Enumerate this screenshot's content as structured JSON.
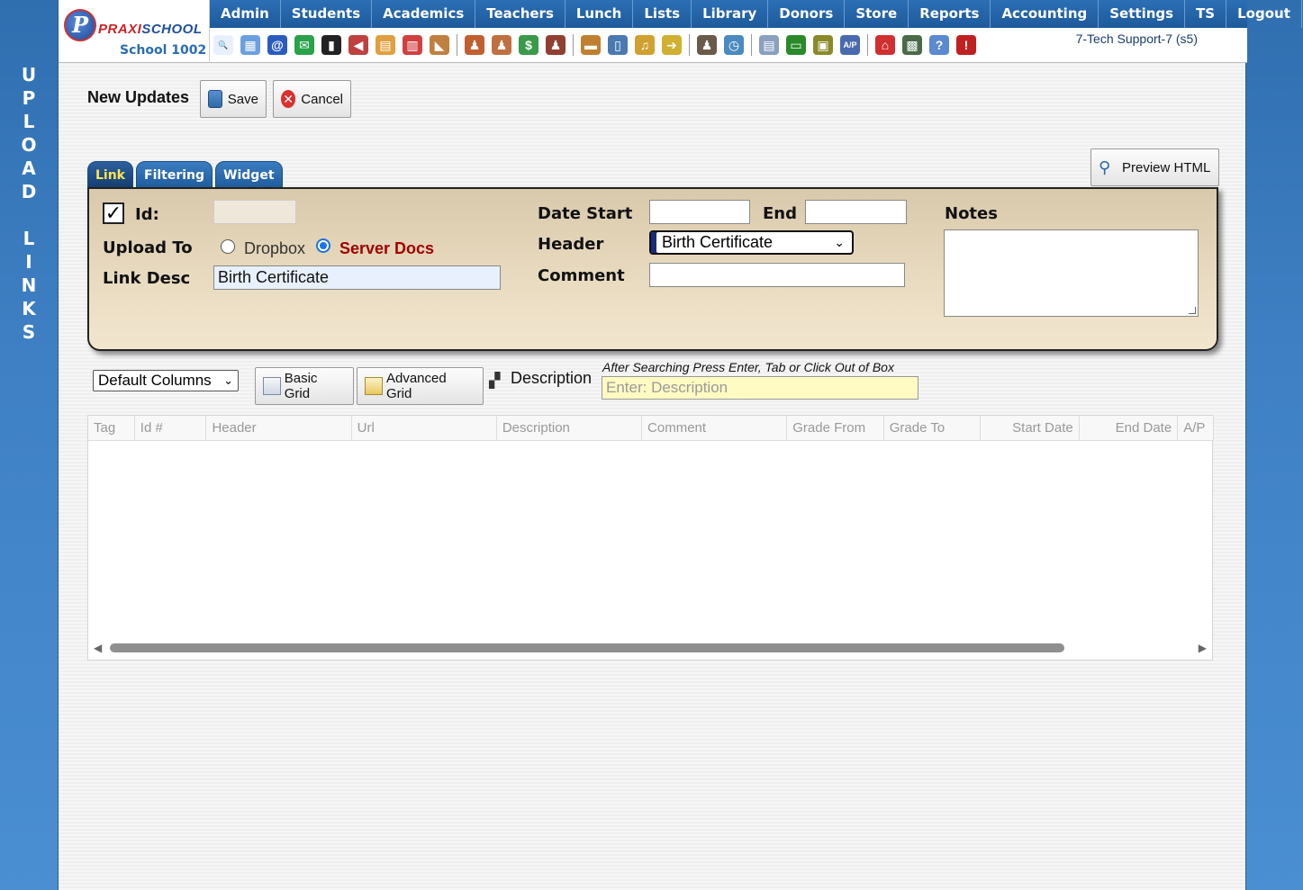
{
  "side_title": [
    "U",
    "P",
    "L",
    "O",
    "A",
    "D",
    "",
    "L",
    "I",
    "N",
    "K",
    "S"
  ],
  "logo": {
    "brand_prefix": "PRAXI",
    "brand_suffix": "SCHOOL",
    "mark": "P",
    "school": "School 1002"
  },
  "menu": [
    "Admin",
    "Students",
    "Academics",
    "Teachers",
    "Lunch",
    "Lists",
    "Library",
    "Donors",
    "Store",
    "Reports",
    "Accounting",
    "Settings",
    "TS",
    "Logout"
  ],
  "toolbar_icons": [
    {
      "name": "search-icon",
      "glyph": "🔍",
      "color": "#e8f0ff"
    },
    {
      "name": "calendar-grid-icon",
      "glyph": "▦",
      "color": "#6aa0e0"
    },
    {
      "name": "email-icon",
      "glyph": "@",
      "color": "#2a5cc0"
    },
    {
      "name": "chat-icon",
      "glyph": "✉",
      "color": "#2aa24a"
    },
    {
      "name": "phone-icon",
      "glyph": "▮",
      "color": "#222"
    },
    {
      "name": "speaker-icon",
      "glyph": "◀",
      "color": "#c04040"
    },
    {
      "name": "notepad-icon",
      "glyph": "▤",
      "color": "#e0a040"
    },
    {
      "name": "calendar-icon",
      "glyph": "▥",
      "color": "#d04040"
    },
    {
      "name": "megaphone-icon",
      "glyph": "◣",
      "color": "#c08040"
    },
    {
      "name": "sep",
      "glyph": "",
      "color": ""
    },
    {
      "name": "teacher-add-icon",
      "glyph": "♟",
      "color": "#c06030"
    },
    {
      "name": "teacher-icon",
      "glyph": "♟",
      "color": "#c07040"
    },
    {
      "name": "money-icon",
      "glyph": "$",
      "color": "#3a9a4a"
    },
    {
      "name": "users-icon",
      "glyph": "♟",
      "color": "#904030"
    },
    {
      "name": "sep",
      "glyph": "",
      "color": ""
    },
    {
      "name": "lunch-icon",
      "glyph": "▬",
      "color": "#c08030"
    },
    {
      "name": "book-icon",
      "glyph": "▯",
      "color": "#4a7ab0"
    },
    {
      "name": "bell-icon",
      "glyph": "♫",
      "color": "#d0a030"
    },
    {
      "name": "export-icon",
      "glyph": "➔",
      "color": "#d0b030"
    },
    {
      "name": "sep",
      "glyph": "",
      "color": ""
    },
    {
      "name": "person-icon",
      "glyph": "♟",
      "color": "#6a5a4a"
    },
    {
      "name": "clock-icon",
      "glyph": "◷",
      "color": "#4a8ac0"
    },
    {
      "name": "sep",
      "glyph": "",
      "color": ""
    },
    {
      "name": "report-icon",
      "glyph": "▤",
      "color": "#8aa0c0"
    },
    {
      "name": "card-icon",
      "glyph": "▭",
      "color": "#2a8a2a"
    },
    {
      "name": "printer-icon",
      "glyph": "▣",
      "color": "#8a8a2a"
    },
    {
      "name": "ap-icon",
      "glyph": "A/P",
      "color": "#4a6ab0"
    },
    {
      "name": "sep",
      "glyph": "",
      "color": ""
    },
    {
      "name": "pdf-icon",
      "glyph": "⌂",
      "color": "#d03030"
    },
    {
      "name": "register-icon",
      "glyph": "▩",
      "color": "#4a6a4a"
    },
    {
      "name": "help-icon",
      "glyph": "?",
      "color": "#5a8ad0"
    },
    {
      "name": "stop-icon",
      "glyph": "!",
      "color": "#c02020"
    }
  ],
  "user": "7-Tech Support-7 (s5)",
  "page": {
    "title": "New Updates",
    "save_label": "Save",
    "cancel_label": "Cancel",
    "preview_label": "Preview HTML"
  },
  "tabs": [
    "Link",
    "Filtering",
    "Widget"
  ],
  "form": {
    "id_label": "Id:",
    "id_value": "",
    "upload_to_label": "Upload To",
    "upload_options": [
      "Dropbox",
      "Server Docs"
    ],
    "upload_selected": "Server Docs",
    "link_desc_label": "Link Desc",
    "link_desc_value": "Birth Certificate",
    "date_start_label": "Date Start",
    "date_start_value": "",
    "end_label": "End",
    "end_value": "",
    "header_label": "Header",
    "header_value": "Birth Certificate",
    "comment_label": "Comment",
    "comment_value": "",
    "notes_label": "Notes",
    "notes_value": ""
  },
  "search": {
    "columns_select": "Default Columns",
    "basic_grid_label": "Basic Grid",
    "advanced_grid_label": "Advanced Grid",
    "field_label": "Description",
    "hint": "After Searching Press Enter, Tab or Click Out of Box",
    "placeholder": "Enter: Description"
  },
  "grid": {
    "columns": [
      "Tag",
      "Id #",
      "Header",
      "Url",
      "Description",
      "Comment",
      "Grade From",
      "Grade To",
      "Start Date",
      "End Date",
      "A/P"
    ]
  }
}
